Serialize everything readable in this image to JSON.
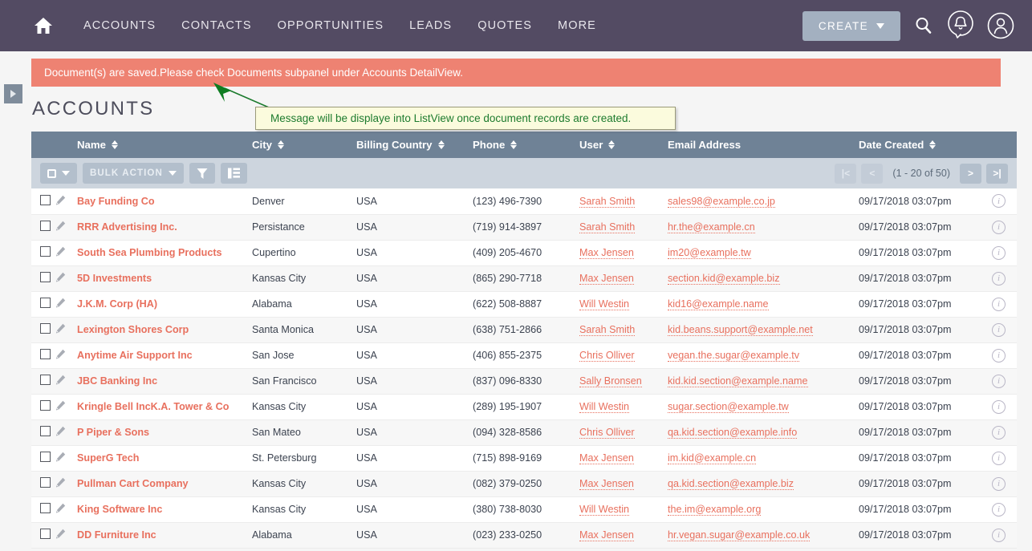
{
  "navbar": {
    "home_icon": "home-icon",
    "links": [
      "ACCOUNTS",
      "CONTACTS",
      "OPPORTUNITIES",
      "LEADS",
      "QUOTES",
      "MORE"
    ],
    "create_label": "CREATE",
    "search_icon": "search-icon",
    "notification_icon": "notification-bell-icon",
    "profile_icon": "user-profile-icon",
    "bg_color": "#534b63",
    "create_bg": "#a3b0c0"
  },
  "alert": {
    "message": "Document(s) are saved.Please check Documents subpanel under Accounts DetailView.",
    "bg_color": "#ee8272"
  },
  "callout": {
    "text": "Message will be displaye into ListView once document records are created.",
    "bg_color": "#fbfbdd",
    "text_color": "#1d7b2e"
  },
  "sidebar_toggle": {
    "icon": "expand-sidebar-icon"
  },
  "page": {
    "title": "ACCOUNTS"
  },
  "table": {
    "header_bg": "#6f8296",
    "columns": [
      {
        "label": "Name",
        "sortable": true
      },
      {
        "label": "City",
        "sortable": true
      },
      {
        "label": "Billing Country",
        "sortable": true
      },
      {
        "label": "Phone",
        "sortable": true
      },
      {
        "label": "User",
        "sortable": true
      },
      {
        "label": "Email Address",
        "sortable": false
      },
      {
        "label": "Date Created",
        "sortable": true
      }
    ],
    "toolbar": {
      "select_all_icon": "checkbox-dropdown-icon",
      "bulk_action_label": "BULK ACTION",
      "filter_icon": "funnel-filter-icon",
      "column_chooser_icon": "column-chooser-icon"
    },
    "pagination": {
      "first_label": "|<",
      "prev_label": "<",
      "count_label": "(1 - 20 of 50)",
      "next_label": ">",
      "last_label": ">|"
    },
    "rows": [
      {
        "name": "Bay Funding Co",
        "city": "Denver",
        "country": "USA",
        "phone": "(123) 496-7390",
        "user": "Sarah Smith",
        "email": "sales98@example.co.jp",
        "date": "09/17/2018 03:07pm"
      },
      {
        "name": "RRR Advertising Inc.",
        "city": "Persistance",
        "country": "USA",
        "phone": "(719) 914-3897",
        "user": "Sarah Smith",
        "email": "hr.the@example.cn",
        "date": "09/17/2018 03:07pm"
      },
      {
        "name": "South Sea Plumbing Products",
        "city": "Cupertino",
        "country": "USA",
        "phone": "(409) 205-4670",
        "user": "Max Jensen",
        "email": "im20@example.tw",
        "date": "09/17/2018 03:07pm"
      },
      {
        "name": "5D Investments",
        "city": "Kansas City",
        "country": "USA",
        "phone": "(865) 290-7718",
        "user": "Max Jensen",
        "email": "section.kid@example.biz",
        "date": "09/17/2018 03:07pm"
      },
      {
        "name": "J.K.M. Corp (HA)",
        "city": "Alabama",
        "country": "USA",
        "phone": "(622) 508-8887",
        "user": "Will Westin",
        "email": "kid16@example.name",
        "date": "09/17/2018 03:07pm"
      },
      {
        "name": "Lexington Shores Corp",
        "city": "Santa Monica",
        "country": "USA",
        "phone": "(638) 751-2866",
        "user": "Sarah Smith",
        "email": "kid.beans.support@example.net",
        "date": "09/17/2018 03:07pm"
      },
      {
        "name": "Anytime Air Support Inc",
        "city": "San Jose",
        "country": "USA",
        "phone": "(406) 855-2375",
        "user": "Chris Olliver",
        "email": "vegan.the.sugar@example.tv",
        "date": "09/17/2018 03:07pm"
      },
      {
        "name": "JBC Banking Inc",
        "city": "San Francisco",
        "country": "USA",
        "phone": "(837) 096-8330",
        "user": "Sally Bronsen",
        "email": "kid.kid.section@example.name",
        "date": "09/17/2018 03:07pm"
      },
      {
        "name": "Kringle Bell IncK.A. Tower & Co",
        "city": "Kansas City",
        "country": "USA",
        "phone": "(289) 195-1907",
        "user": "Will Westin",
        "email": "sugar.section@example.tw",
        "date": "09/17/2018 03:07pm"
      },
      {
        "name": "P Piper & Sons",
        "city": "San Mateo",
        "country": "USA",
        "phone": "(094) 328-8586",
        "user": "Chris Olliver",
        "email": "qa.kid.section@example.info",
        "date": "09/17/2018 03:07pm"
      },
      {
        "name": "SuperG Tech",
        "city": "St. Petersburg",
        "country": "USA",
        "phone": "(715) 898-9169",
        "user": "Max Jensen",
        "email": "im.kid@example.cn",
        "date": "09/17/2018 03:07pm"
      },
      {
        "name": "Pullman Cart Company",
        "city": "Kansas City",
        "country": "USA",
        "phone": "(082) 379-0250",
        "user": "Max Jensen",
        "email": "qa.kid.section@example.biz",
        "date": "09/17/2018 03:07pm"
      },
      {
        "name": "King Software Inc",
        "city": "Kansas City",
        "country": "USA",
        "phone": "(380) 738-8030",
        "user": "Will Westin",
        "email": "the.im@example.org",
        "date": "09/17/2018 03:07pm"
      },
      {
        "name": "DD Furniture Inc",
        "city": "Alabama",
        "country": "USA",
        "phone": "(023) 233-0250",
        "user": "Max Jensen",
        "email": "hr.vegan.sugar@example.co.uk",
        "date": "09/17/2018 03:07pm"
      }
    ]
  }
}
